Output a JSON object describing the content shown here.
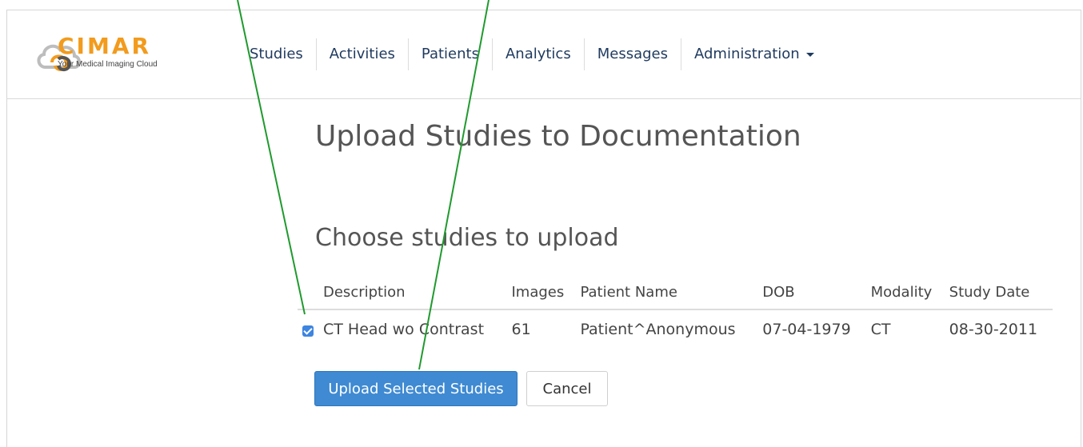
{
  "brand": {
    "name": "CIMAR",
    "tagline": "Your Medical Imaging Cloud",
    "color": "#f29b1d"
  },
  "nav": {
    "items": [
      {
        "label": "Studies"
      },
      {
        "label": "Activities"
      },
      {
        "label": "Patients"
      },
      {
        "label": "Analytics"
      },
      {
        "label": "Messages"
      },
      {
        "label": "Administration",
        "has_dropdown": true
      }
    ]
  },
  "page": {
    "title": "Upload Studies to Documentation",
    "subtitle": "Choose studies to upload"
  },
  "table": {
    "columns": [
      "Description",
      "Images",
      "Patient Name",
      "DOB",
      "Modality",
      "Study Date"
    ],
    "rows": [
      {
        "selected": true,
        "description": "CT Head wo Contrast",
        "images": "61",
        "patient_name": "Patient^Anonymous",
        "dob": "07-04-1979",
        "modality": "CT",
        "study_date": "08-30-2011"
      }
    ]
  },
  "actions": {
    "upload_label": "Upload Selected Studies",
    "cancel_label": "Cancel"
  },
  "colors": {
    "primary_button": "#3f8ad2",
    "nav_text": "#1f3a5f",
    "annotation_line": "#1f9a2e"
  }
}
